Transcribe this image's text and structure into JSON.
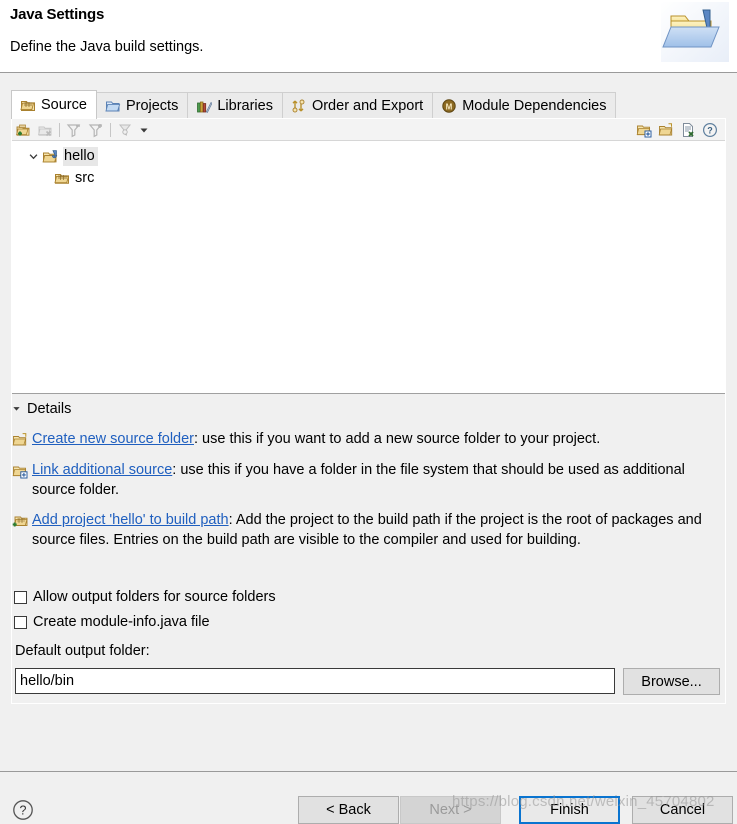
{
  "header": {
    "title": "Java Settings",
    "description": "Define the Java build settings.",
    "icon": "java-folder-icon"
  },
  "tabs": [
    {
      "label": "Source",
      "icon": "source-folder-icon",
      "selected": true
    },
    {
      "label": "Projects",
      "icon": "open-folder-icon",
      "selected": false
    },
    {
      "label": "Libraries",
      "icon": "books-icon",
      "selected": false
    },
    {
      "label": "Order and Export",
      "icon": "order-arrows-icon",
      "selected": false
    },
    {
      "label": "Module Dependencies",
      "icon": "module-circle-icon",
      "selected": false
    }
  ],
  "tree_toolbar": {
    "left_buttons": [
      {
        "name": "add-source-folder-icon",
        "title": "Add Folder"
      },
      {
        "name": "remove-source-folder-icon",
        "title": "Remove"
      },
      {
        "name": "filter-remove-icon",
        "title": "Remove Filter"
      },
      {
        "name": "filter-add-icon",
        "title": "Add Filter"
      },
      {
        "name": "configure-filters-icon",
        "title": "Configure"
      }
    ],
    "dropdown_caret": "chevron-down-icon",
    "right_buttons": [
      {
        "name": "link-source-icon",
        "title": "Link Source"
      },
      {
        "name": "new-folder-icon",
        "title": "New Folder"
      },
      {
        "name": "exclude-file-icon",
        "title": "Exclude"
      },
      {
        "name": "help-circle-icon",
        "title": "Help"
      }
    ]
  },
  "tree": {
    "root": {
      "label": "hello",
      "icon": "project-folder-icon",
      "expanded": true,
      "selected": true,
      "twisty": "chevron-down-icon"
    },
    "children": [
      {
        "label": "src",
        "icon": "source-folder-icon",
        "selected": false
      }
    ]
  },
  "details": {
    "section_label": "Details",
    "section_twisty": "triangle-down-icon",
    "items": [
      {
        "icon": "new-source-folder-icon",
        "link": "Create new source folder",
        "text": ": use this if you want to add a new source folder to your project."
      },
      {
        "icon": "link-source-folder-icon",
        "link": "Link additional source",
        "text": ": use this if you have a folder in the file system that should be used as additional source folder."
      },
      {
        "icon": "add-project-buildpath-icon",
        "link": "Add project 'hello' to build path",
        "text": ": Add the project to the build path if the project is the root of packages and source files. Entries on the build path are visible to the compiler and used for building."
      }
    ]
  },
  "checkboxes": [
    {
      "label": "Allow output folders for source folders",
      "checked": false
    },
    {
      "label": "Create module-info.java file",
      "checked": false
    }
  ],
  "output_folder": {
    "label": "Default output folder:",
    "value": "hello/bin",
    "placeholder": "",
    "browse_label": "Browse..."
  },
  "footer": {
    "help_icon": "help-circle-icon",
    "back_label": "< Back",
    "next_label": "Next >",
    "finish_label": "Finish",
    "cancel_label": "Cancel",
    "next_enabled": false,
    "finish_default": true
  },
  "watermark": {
    "text": "https://blog.csdn.net/weixin_45704802"
  },
  "colors": {
    "dialog_bg": "#f0f0f0",
    "header_bg": "#ffffff",
    "panel_bg": "#ffffff",
    "link": "#1f5fbf",
    "focus_border": "#0a74d0",
    "selection_bg": "#e7e7e7",
    "border": "#a0a0a0"
  }
}
